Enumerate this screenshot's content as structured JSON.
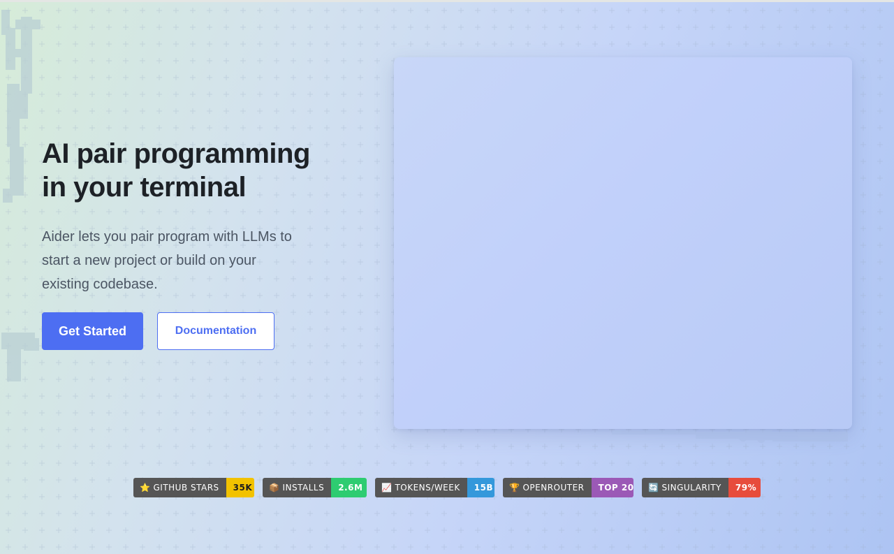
{
  "hero": {
    "title_line1": "AI pair programming",
    "title_line2": "in your terminal",
    "description": "Aider lets you pair program with LLMs to start a new project or build on your existing codebase.",
    "primary_button": "Get Started",
    "secondary_button": "Documentation"
  },
  "colors": {
    "accent": "#4d6ef2",
    "badge_label_bg": "#555555"
  },
  "badges": [
    {
      "icon": "star-icon",
      "glyph": "⭐",
      "label": "GITHUB STARS",
      "value": "35K",
      "color": "#f2c200",
      "value_text_color": "#1d1d1d"
    },
    {
      "icon": "package-icon",
      "glyph": "📦",
      "label": "INSTALLS",
      "value": "2.6M",
      "color": "#2ecc71",
      "value_text_color": "#ffffff"
    },
    {
      "icon": "chart-icon",
      "glyph": "📈",
      "label": "TOKENS/WEEK",
      "value": "15B",
      "color": "#3498db",
      "value_text_color": "#ffffff"
    },
    {
      "icon": "trophy-icon",
      "glyph": "🏆",
      "label": "OPENROUTER",
      "value": "TOP 20",
      "color": "#9b59b6",
      "value_text_color": "#ffffff"
    },
    {
      "icon": "cycle-icon",
      "glyph": "🔄",
      "label": "SINGULARITY",
      "value": "79%",
      "color": "#e74c3c",
      "value_text_color": "#ffffff"
    }
  ]
}
